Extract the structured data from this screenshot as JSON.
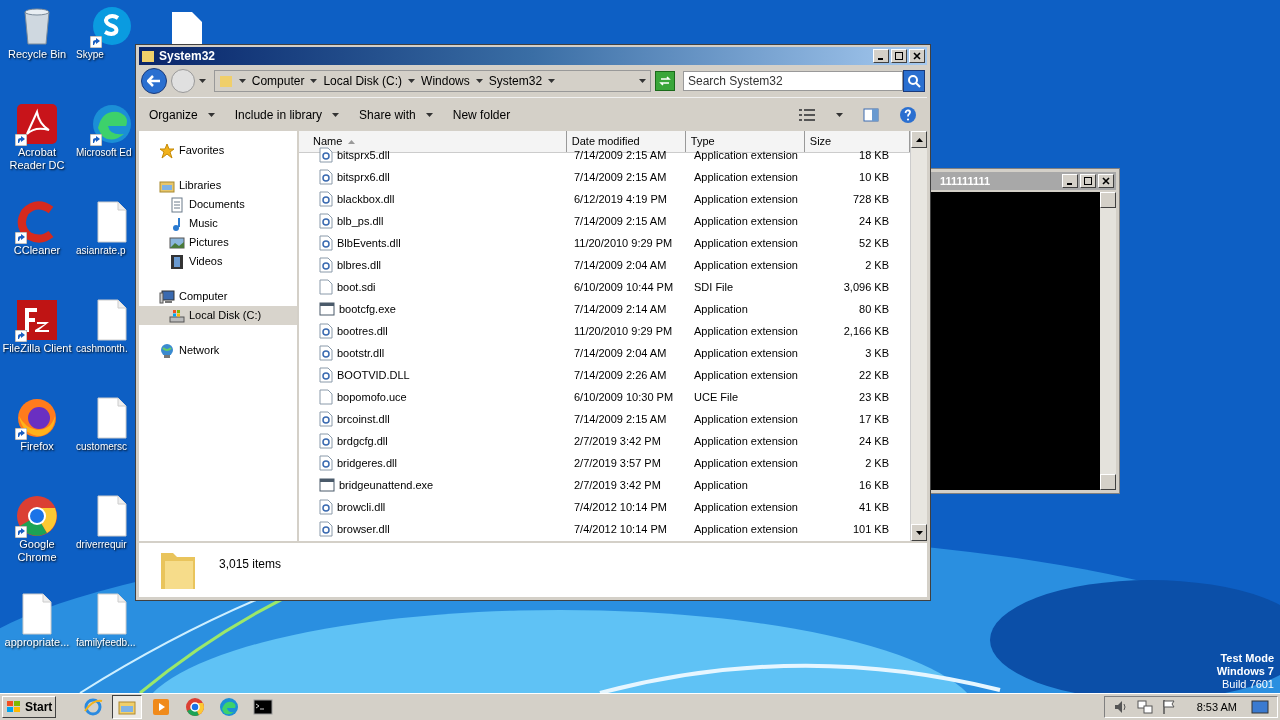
{
  "desktop_icons": [
    {
      "label": "Recycle Bin",
      "kind": "bin",
      "shortcut": false
    },
    {
      "label": "Skype",
      "kind": "skype",
      "shortcut": true
    },
    {
      "label": "Acrobat Reader DC",
      "kind": "acrobat",
      "shortcut": true
    },
    {
      "label": "Microsoft Ed",
      "kind": "edge",
      "shortcut": true
    },
    {
      "label": "CCleaner",
      "kind": "ccleaner",
      "shortcut": true
    },
    {
      "label": "asianrate.p",
      "kind": "file",
      "shortcut": false
    },
    {
      "label": "FileZilla Client",
      "kind": "filezilla",
      "shortcut": true
    },
    {
      "label": "cashmonth.",
      "kind": "file",
      "shortcut": false
    },
    {
      "label": "Firefox",
      "kind": "firefox",
      "shortcut": true
    },
    {
      "label": "customersc",
      "kind": "file",
      "shortcut": false
    },
    {
      "label": "Google Chrome",
      "kind": "chrome",
      "shortcut": true
    },
    {
      "label": "driverrequir",
      "kind": "file",
      "shortcut": false
    },
    {
      "label": "appropriate...",
      "kind": "file",
      "shortcut": false
    },
    {
      "label": "familyfeedb...",
      "kind": "file",
      "shortcut": false
    }
  ],
  "explorer": {
    "title": "System32",
    "breadcrumb": [
      "Computer",
      "Local Disk (C:)",
      "Windows",
      "System32"
    ],
    "search": {
      "placeholder": "Search System32"
    },
    "toolbar": [
      {
        "label": "Organize",
        "dropdown": true
      },
      {
        "label": "Include in library",
        "dropdown": true
      },
      {
        "label": "Share with",
        "dropdown": true
      },
      {
        "label": "New folder",
        "dropdown": false
      }
    ],
    "nav": [
      {
        "label": "Favorites",
        "kind": "star",
        "selected": false
      },
      {
        "label": "Libraries",
        "kind": "library",
        "selected": false,
        "children": [
          {
            "label": "Documents",
            "kind": "document",
            "selected": false
          },
          {
            "label": "Music",
            "kind": "music",
            "selected": false
          },
          {
            "label": "Pictures",
            "kind": "picture",
            "selected": false
          },
          {
            "label": "Videos",
            "kind": "video",
            "selected": false
          }
        ]
      },
      {
        "label": "Computer",
        "kind": "computer",
        "selected": false,
        "children": [
          {
            "label": "Local Disk (C:)",
            "kind": "disk",
            "selected": true
          }
        ]
      },
      {
        "label": "Network",
        "kind": "network",
        "selected": false
      }
    ],
    "columns": [
      "Name",
      "Date modified",
      "Type",
      "Size"
    ],
    "rows": [
      {
        "name": "bitsprx5.dll",
        "date": "7/14/2009 2:15 AM",
        "type": "Application extension",
        "size": "18 KB",
        "kind": "dll"
      },
      {
        "name": "bitsprx6.dll",
        "date": "7/14/2009 2:15 AM",
        "type": "Application extension",
        "size": "10 KB",
        "kind": "dll"
      },
      {
        "name": "blackbox.dll",
        "date": "6/12/2019 4:19 PM",
        "type": "Application extension",
        "size": "728 KB",
        "kind": "dll"
      },
      {
        "name": "blb_ps.dll",
        "date": "7/14/2009 2:15 AM",
        "type": "Application extension",
        "size": "24 KB",
        "kind": "dll"
      },
      {
        "name": "BlbEvents.dll",
        "date": "11/20/2010 9:29 PM",
        "type": "Application extension",
        "size": "52 KB",
        "kind": "dll"
      },
      {
        "name": "blbres.dll",
        "date": "7/14/2009 2:04 AM",
        "type": "Application extension",
        "size": "2 KB",
        "kind": "dll"
      },
      {
        "name": "boot.sdi",
        "date": "6/10/2009 10:44 PM",
        "type": "SDI File",
        "size": "3,096 KB",
        "kind": "file"
      },
      {
        "name": "bootcfg.exe",
        "date": "7/14/2009 2:14 AM",
        "type": "Application",
        "size": "80 KB",
        "kind": "exe"
      },
      {
        "name": "bootres.dll",
        "date": "11/20/2010 9:29 PM",
        "type": "Application extension",
        "size": "2,166 KB",
        "kind": "dll"
      },
      {
        "name": "bootstr.dll",
        "date": "7/14/2009 2:04 AM",
        "type": "Application extension",
        "size": "3 KB",
        "kind": "dll"
      },
      {
        "name": "BOOTVID.DLL",
        "date": "7/14/2009 2:26 AM",
        "type": "Application extension",
        "size": "22 KB",
        "kind": "dll"
      },
      {
        "name": "bopomofo.uce",
        "date": "6/10/2009 10:30 PM",
        "type": "UCE File",
        "size": "23 KB",
        "kind": "file"
      },
      {
        "name": "brcoinst.dll",
        "date": "7/14/2009 2:15 AM",
        "type": "Application extension",
        "size": "17 KB",
        "kind": "dll"
      },
      {
        "name": "brdgcfg.dll",
        "date": "2/7/2019 3:42 PM",
        "type": "Application extension",
        "size": "24 KB",
        "kind": "dll"
      },
      {
        "name": "bridgeres.dll",
        "date": "2/7/2019 3:57 PM",
        "type": "Application extension",
        "size": "2 KB",
        "kind": "dll"
      },
      {
        "name": "bridgeunattend.exe",
        "date": "2/7/2019 3:42 PM",
        "type": "Application",
        "size": "16 KB",
        "kind": "exe"
      },
      {
        "name": "browcli.dll",
        "date": "7/4/2012 10:14 PM",
        "type": "Application extension",
        "size": "41 KB",
        "kind": "dll"
      },
      {
        "name": "browser.dll",
        "date": "7/4/2012 10:14 PM",
        "type": "Application extension",
        "size": "101 KB",
        "kind": "dll"
      }
    ],
    "item_count": "3,015 items"
  },
  "console": {
    "title": "111111111"
  },
  "os_info": [
    "Test Mode",
    "Windows 7",
    "Build 7601"
  ],
  "taskbar": {
    "start": "Start",
    "apps": [
      {
        "kind": "ie",
        "active": false
      },
      {
        "kind": "explorer",
        "active": true
      },
      {
        "kind": "media",
        "active": false
      },
      {
        "kind": "chrome",
        "active": false
      },
      {
        "kind": "edge",
        "active": false
      },
      {
        "kind": "cmd",
        "active": false
      }
    ],
    "clock": "8:53 AM"
  }
}
